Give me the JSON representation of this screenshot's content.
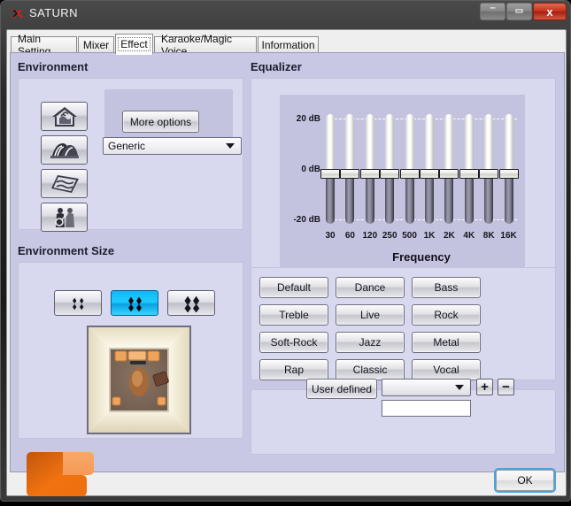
{
  "window": {
    "title": "SATURN",
    "icon": "saturn-logo-icon",
    "minimize_label": "–",
    "maximize_label": "▭",
    "close_label": "x"
  },
  "tabs": [
    {
      "label": "Main Setting",
      "active": false
    },
    {
      "label": "Mixer",
      "active": false
    },
    {
      "label": "Effect",
      "active": true
    },
    {
      "label": "Karaoke/Magic Voice",
      "active": false
    },
    {
      "label": "Information",
      "active": false
    }
  ],
  "environment": {
    "title": "Environment",
    "buttons": [
      {
        "icon": "house-room-icon"
      },
      {
        "icon": "arena-hall-icon"
      },
      {
        "icon": "carpet-plate-icon"
      },
      {
        "icon": "concert-people-icon"
      }
    ],
    "more_options_label": "More options",
    "select_value": "Generic",
    "select_caret": "chevron-down-icon"
  },
  "environment_size": {
    "title": "Environment Size",
    "buttons": [
      {
        "size": "small",
        "selected": false
      },
      {
        "size": "medium",
        "selected": true
      },
      {
        "size": "large",
        "selected": false
      }
    ],
    "preview": "top-down-room-preview"
  },
  "equalizer": {
    "title": "Equalizer",
    "frequency_axis_label": "Frequency",
    "db_labels": [
      "20 dB",
      "0  dB",
      "-20 dB"
    ],
    "user_defined": {
      "button_label": "User defined",
      "select_value": "",
      "text_value": "",
      "add_label": "+",
      "remove_label": "−"
    },
    "presets": [
      "Default",
      "Dance",
      "Bass",
      "Treble",
      "Live",
      "Rock",
      "Soft-Rock",
      "Jazz",
      "Metal",
      "Rap",
      "Classic",
      "Vocal"
    ]
  },
  "chart_data": {
    "type": "bar",
    "title": "Equalizer",
    "xlabel": "Frequency",
    "ylabel": "dB",
    "ylim": [
      -20,
      20
    ],
    "grid": true,
    "categories": [
      "30",
      "60",
      "120",
      "250",
      "500",
      "1K",
      "2K",
      "4K",
      "8K",
      "16K"
    ],
    "values": [
      0,
      0,
      0,
      0,
      0,
      0,
      0,
      0,
      0,
      0
    ],
    "ytick_labels": [
      "20 dB",
      "0  dB",
      "-20 dB"
    ],
    "yticks": [
      20,
      0,
      -20
    ]
  },
  "footer": {
    "ok_label": "OK",
    "logo": "orange-blocks-logo"
  },
  "colors": {
    "page_bg": "#c8c8e4",
    "panel_bg": "#d8d8ee",
    "subpanel_bg": "#c3c3e0",
    "accent_selected": "#14b8f6",
    "close_btn": "#c5301a",
    "focus_ring": "#4aa3dd",
    "logo_orange": "#ee7012"
  }
}
